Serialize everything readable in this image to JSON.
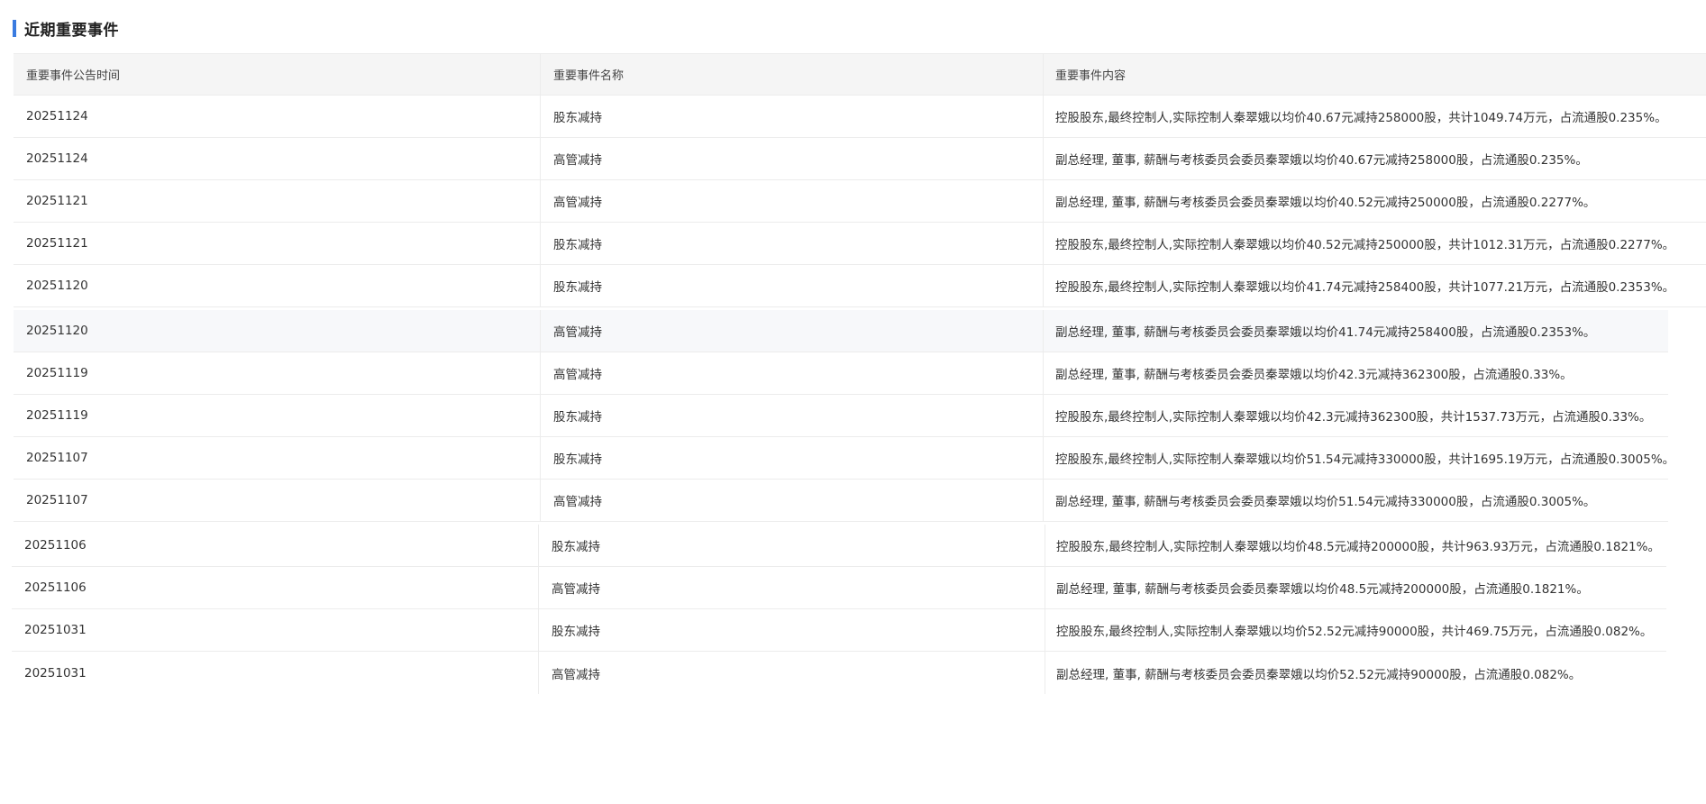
{
  "section": {
    "title": "近期重要事件"
  },
  "table": {
    "headers": [
      "重要事件公告时间",
      "重要事件名称",
      "重要事件内容"
    ],
    "rows": [
      {
        "date": "20251124",
        "name": "股东减持",
        "content": "控股股东,最终控制人,实际控制人秦翠娥以均价40.67元减持258000股，共计1049.74万元，占流通股0.235%。"
      },
      {
        "date": "20251124",
        "name": "高管减持",
        "content": "副总经理, 董事, 薪酬与考核委员会委员秦翠娥以均价40.67元减持258000股，占流通股0.235%。"
      },
      {
        "date": "20251121",
        "name": "高管减持",
        "content": "副总经理, 董事, 薪酬与考核委员会委员秦翠娥以均价40.52元减持250000股，占流通股0.2277%。"
      },
      {
        "date": "20251121",
        "name": "股东减持",
        "content": "控股股东,最终控制人,实际控制人秦翠娥以均价40.52元减持250000股，共计1012.31万元，占流通股0.2277%。"
      },
      {
        "date": "20251120",
        "name": "股东减持",
        "content": "控股股东,最终控制人,实际控制人秦翠娥以均价41.74元减持258400股，共计1077.21万元，占流通股0.2353%。"
      },
      {
        "date": "20251120",
        "name": "高管减持",
        "content": "副总经理, 董事, 薪酬与考核委员会委员秦翠娥以均价41.74元减持258400股，占流通股0.2353%。"
      },
      {
        "date": "20251119",
        "name": "高管减持",
        "content": "副总经理, 董事, 薪酬与考核委员会委员秦翠娥以均价42.3元减持362300股，占流通股0.33%。"
      },
      {
        "date": "20251119",
        "name": "股东减持",
        "content": "控股股东,最终控制人,实际控制人秦翠娥以均价42.3元减持362300股，共计1537.73万元，占流通股0.33%。"
      },
      {
        "date": "20251107",
        "name": "股东减持",
        "content": "控股股东,最终控制人,实际控制人秦翠娥以均价51.54元减持330000股，共计1695.19万元，占流通股0.3005%。"
      },
      {
        "date": "20251107",
        "name": "高管减持",
        "content": "副总经理, 董事, 薪酬与考核委员会委员秦翠娥以均价51.54元减持330000股，占流通股0.3005%。"
      },
      {
        "date": "20251106",
        "name": "股东减持",
        "content": "控股股东,最终控制人,实际控制人秦翠娥以均价48.5元减持200000股，共计963.93万元，占流通股0.1821%。"
      },
      {
        "date": "20251106",
        "name": "高管减持",
        "content": "副总经理, 董事, 薪酬与考核委员会委员秦翠娥以均价48.5元减持200000股，占流通股0.1821%。"
      },
      {
        "date": "20251031",
        "name": "股东减持",
        "content": "控股股东,最终控制人,实际控制人秦翠娥以均价52.52元减持90000股，共计469.75万元，占流通股0.082%。"
      },
      {
        "date": "20251031",
        "name": "高管减持",
        "content": "副总经理, 董事, 薪酬与考核委员会委员秦翠娥以均价52.52元减持90000股，占流通股0.082%。"
      }
    ]
  },
  "colors": {
    "accent": "#3a7be0",
    "header_bg": "#f5f5f5",
    "row_highlight_bg": "#f7f8fa",
    "border": "#ececec",
    "text": "#333333"
  }
}
